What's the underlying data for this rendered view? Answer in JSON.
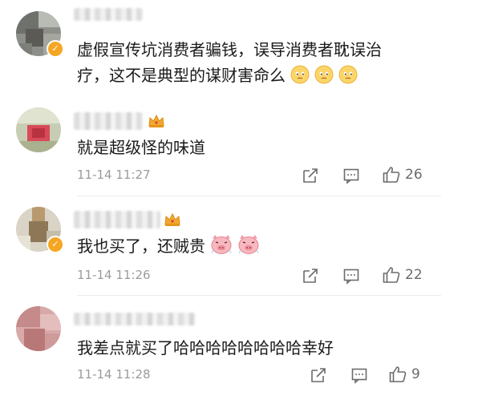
{
  "comments": [
    {
      "text_line1": "虚假宣传坑消费者骗钱，误导消费者耽误治",
      "text_line2": "疗，这不是典型的谋财害命么",
      "emoji": "slightly-frowning-face-icon",
      "verified_badge": "✓"
    },
    {
      "text": "就是超级怪的味道",
      "time": "11-14 11:27",
      "likes": "26"
    },
    {
      "text": "我也买了，还贼贵",
      "emoji": "pig-face-icon",
      "time": "11-14 11:26",
      "likes": "22",
      "verified_badge": "✓"
    },
    {
      "text": "我差点就买了哈哈哈哈哈哈哈哈幸好",
      "time": "11-14 11:28",
      "likes": "9"
    }
  ],
  "colors": {
    "meta_text": "#9b9b9b",
    "badge": "#f5a623",
    "crown": "#f0a92e",
    "divider": "#ececec"
  }
}
